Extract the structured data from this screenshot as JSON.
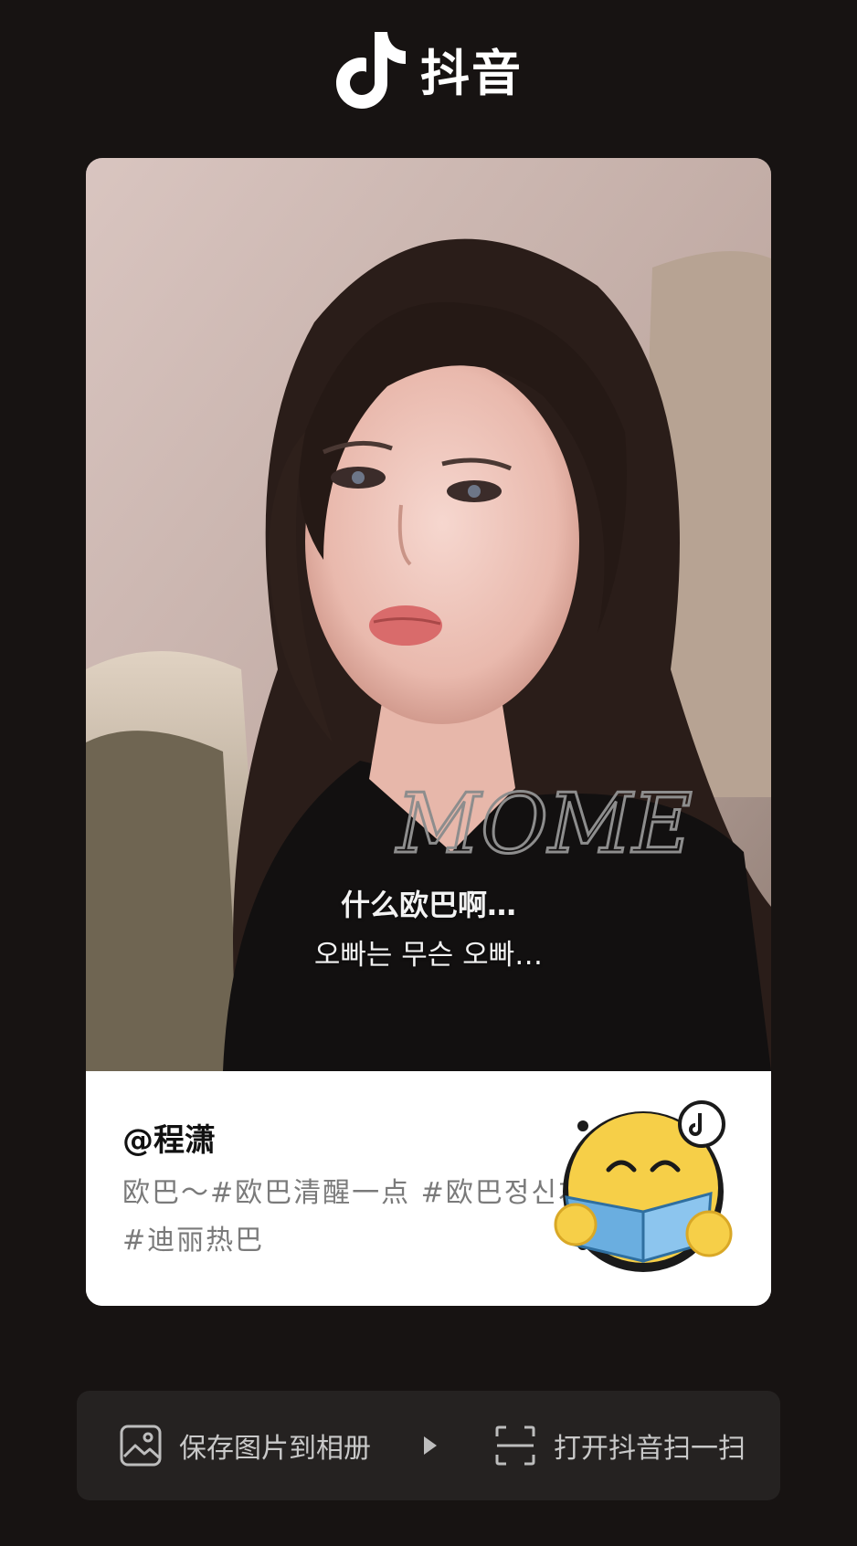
{
  "header": {
    "logo_icon": "tiktok-note-icon",
    "app_name": "抖音"
  },
  "card": {
    "subtitle_cn": "什么欧巴啊…",
    "subtitle_kr": "오빠는 무슨 오빠…",
    "username": "@程潇",
    "description": "欧巴～#欧巴清醒一点 #欧巴정신차리 #迪丽热巴",
    "qr_icon": "smiley-reading-book-qr-icon"
  },
  "actions": {
    "save_icon": "image-icon",
    "save_label": "保存图片到相册",
    "separator_icon": "play-triangle-icon",
    "scan_icon": "scan-icon",
    "scan_label": "打开抖音扫一扫"
  },
  "colors": {
    "background": "#171312",
    "card_white": "#ffffff",
    "bar_bg": "#252221",
    "qr_yellow": "#f6cf48",
    "book_blue": "#6aaee0"
  }
}
